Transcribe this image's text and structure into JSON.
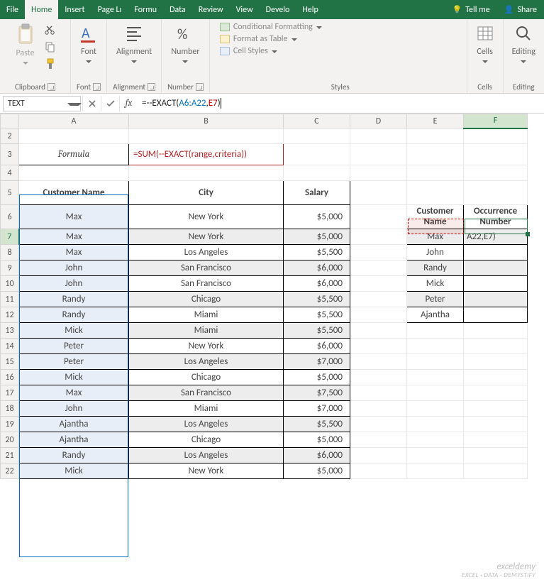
{
  "tabs": [
    "File",
    "Home",
    "Insert",
    "Page Lı",
    "Formu",
    "Data",
    "Review",
    "View",
    "Develo",
    "Help"
  ],
  "activeTab": "Home",
  "tellme": "Tell me",
  "share": "Share",
  "ribbon": {
    "clipboard": {
      "paste": "Paste",
      "label": "Clipboard"
    },
    "font": {
      "btn": "Font",
      "label": "Font"
    },
    "alignment": {
      "btn": "Alignment",
      "label": "Alignment"
    },
    "number": {
      "btn": "Number",
      "label": "Number"
    },
    "styles": {
      "cond": "Conditional Formatting",
      "fat": "Format as Table",
      "cell": "Cell Styles",
      "label": "Styles"
    },
    "cells": {
      "btn": "Cells",
      "label": "Cells"
    },
    "editing": {
      "btn": "Editing",
      "label": "Editing"
    }
  },
  "namebox": "TEXT",
  "formula": {
    "prefix": "=--EXACT(",
    "ref1": "A6:A22",
    "comma": ",",
    "ref2": "E7",
    "suffix": ")"
  },
  "columns": [
    "A",
    "B",
    "C",
    "D",
    "E",
    "F"
  ],
  "rows_start": 2,
  "rows_end": 22,
  "row3": {
    "label": "Formula",
    "value": "=SUM(--EXACT(range,criteria))"
  },
  "main_headers": [
    "Customer Name",
    "City",
    "Salary"
  ],
  "main_data": [
    {
      "r": 6,
      "name": "Max",
      "city": "New York",
      "salary": "$5,000",
      "band": false
    },
    {
      "r": 7,
      "name": "Max",
      "city": "New York",
      "salary": "$5,000",
      "band": true
    },
    {
      "r": 8,
      "name": "Max",
      "city": "Los Angeles",
      "salary": "$5,500",
      "band": false
    },
    {
      "r": 9,
      "name": "John",
      "city": "San Francisco",
      "salary": "$6,000",
      "band": true
    },
    {
      "r": 10,
      "name": "John",
      "city": "San Francisco",
      "salary": "$6,000",
      "band": false
    },
    {
      "r": 11,
      "name": "Randy",
      "city": "Chicago",
      "salary": "$5,500",
      "band": true
    },
    {
      "r": 12,
      "name": "Randy",
      "city": "Miami",
      "salary": "$5,500",
      "band": false
    },
    {
      "r": 13,
      "name": "Mick",
      "city": "Miami",
      "salary": "$5,500",
      "band": true
    },
    {
      "r": 14,
      "name": "Peter",
      "city": "New York",
      "salary": "$6,000",
      "band": false
    },
    {
      "r": 15,
      "name": "Peter",
      "city": "Los Angeles",
      "salary": "$7,000",
      "band": true
    },
    {
      "r": 16,
      "name": "Mick",
      "city": "Chicago",
      "salary": "$5,000",
      "band": false
    },
    {
      "r": 17,
      "name": "Max",
      "city": "San Francisco",
      "salary": "$7,500",
      "band": true
    },
    {
      "r": 18,
      "name": "John",
      "city": "Miami",
      "salary": "$7,000",
      "band": false
    },
    {
      "r": 19,
      "name": "Ajantha",
      "city": "Los Angeles",
      "salary": "$5,500",
      "band": true
    },
    {
      "r": 20,
      "name": "Ajantha",
      "city": "Chicago",
      "salary": "$5,000",
      "band": false
    },
    {
      "r": 21,
      "name": "Randy",
      "city": "Los Angeles",
      "salary": "$6,000",
      "band": true
    },
    {
      "r": 22,
      "name": "Mick",
      "city": "New York",
      "salary": "$5,000",
      "band": false
    }
  ],
  "side_headers": [
    "Customer Name",
    "Occurrence Number"
  ],
  "side_data": [
    {
      "r": 7,
      "name": "Max",
      "occ": "A22,E7)",
      "band": true
    },
    {
      "r": 8,
      "name": "John",
      "occ": "",
      "band": false
    },
    {
      "r": 9,
      "name": "Randy",
      "occ": "",
      "band": true
    },
    {
      "r": 10,
      "name": "Mick",
      "occ": "",
      "band": false
    },
    {
      "r": 11,
      "name": "Peter",
      "occ": "",
      "band": true
    },
    {
      "r": 12,
      "name": "Ajantha",
      "occ": "",
      "band": false
    }
  ],
  "watermark": {
    "big": "exceldemy",
    "small": "EXCEL · DATA · DEMYSTIFY"
  }
}
